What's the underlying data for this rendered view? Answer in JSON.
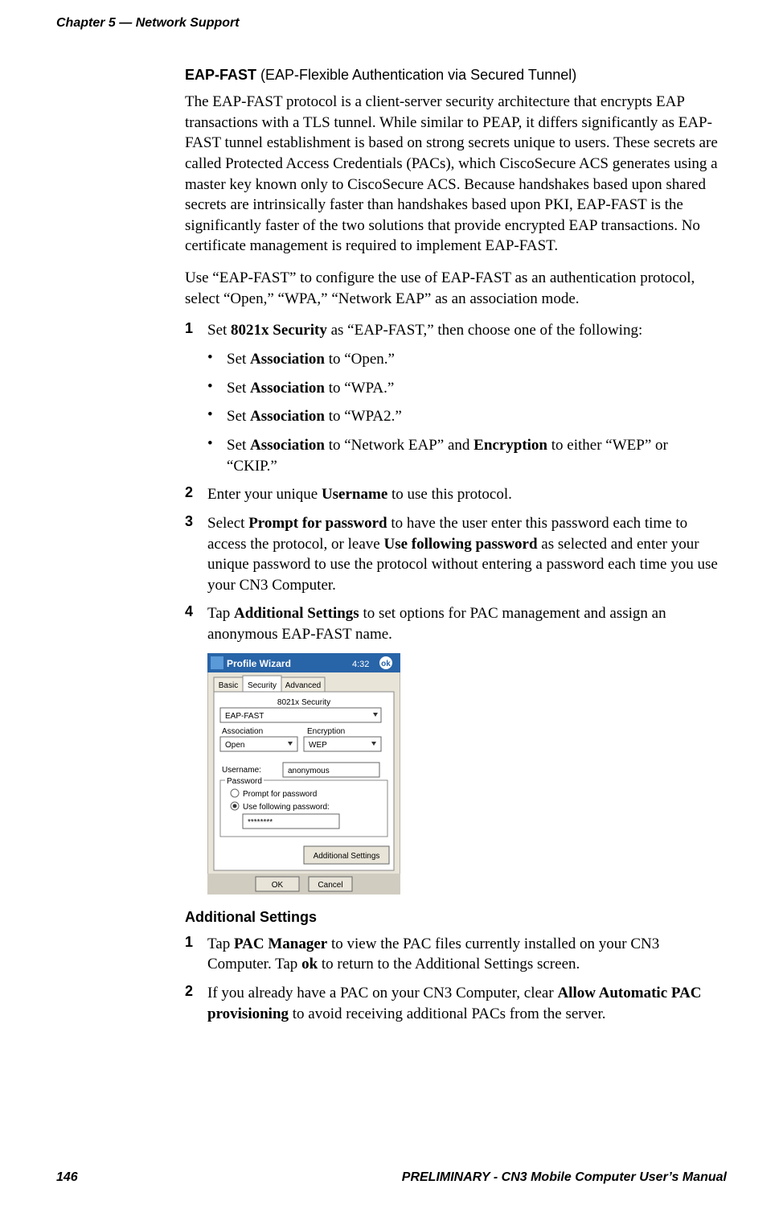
{
  "header": "Chapter 5 — Network Support",
  "section_title_bold": "EAP-FAST",
  "section_title_rest": " (EAP-Flexible Authentication via Secured Tunnel)",
  "para1": "The EAP-FAST protocol is a client-server security architecture that encrypts EAP transactions with a TLS tunnel. While similar to PEAP, it differs significantly as EAP-FAST tunnel establishment is based on strong secrets unique to users. These secrets are called Protected Access Credentials (PACs), which CiscoSecure ACS generates using a master key known only to CiscoSecure ACS. Because handshakes based upon shared secrets are intrinsically faster than handshakes based upon PKI, EAP-FAST is the significantly faster of the two solutions that provide encrypted EAP transactions. No certificate management is required to implement EAP-FAST.",
  "para2": "Use “EAP-FAST” to configure the use of EAP-FAST as an authentication protocol, select “Open,” “WPA,” “Network EAP” as an association mode.",
  "ol1": {
    "num": "1",
    "pre": "Set ",
    "bold": "8021x Security",
    "post": " as “EAP-FAST,” then choose one of the following:"
  },
  "ul_items": [
    {
      "pre": "Set ",
      "bold": "Association",
      "post": " to “Open.”"
    },
    {
      "pre": "Set ",
      "bold": "Association",
      "post": " to “WPA.”"
    },
    {
      "pre": "Set ",
      "bold": "Association",
      "post": " to “WPA2.”"
    },
    {
      "pre": "Set ",
      "bold1": "Association",
      "mid": " to “Network EAP” and ",
      "bold2": "Encryption",
      "post": " to either “WEP” or “CKIP.”"
    }
  ],
  "ol2": {
    "num": "2",
    "pre": "Enter your unique ",
    "bold": "Username",
    "post": " to use this protocol."
  },
  "ol3": {
    "num": "3",
    "pre": "Select ",
    "bold1": "Prompt for password",
    "mid": " to have the user enter this password each time to access the protocol, or leave ",
    "bold2": "Use following password",
    "post": " as selected and enter your unique password to use the protocol without entering a password each time you use your CN3 Computer."
  },
  "ol4": {
    "num": "4",
    "pre": "Tap ",
    "bold": "Additional Settings",
    "post": " to set options for PAC management and assign an anonymous EAP-FAST name."
  },
  "subheading": "Additional Settings",
  "as_ol1": {
    "num": "1",
    "pre": "Tap ",
    "bold1": "PAC Manager",
    "mid": " to view the PAC files currently installed on your CN3 Computer. Tap ",
    "bold2": "ok",
    "post": " to return to the Additional Settings screen."
  },
  "as_ol2": {
    "num": "2",
    "pre": "If you already have a PAC on your CN3 Computer, clear ",
    "bold": "Allow Automatic PAC provisioning",
    "post": " to avoid receiving additional PACs from the server."
  },
  "screenshot": {
    "title": "Profile Wizard",
    "time": "4:32",
    "ok": "ok",
    "tabs": [
      "Basic",
      "Security",
      "Advanced"
    ],
    "sec_label": "8021x Security",
    "sec_value": "EAP-FAST",
    "assoc_label": "Association",
    "assoc_value": "Open",
    "enc_label": "Encryption",
    "enc_value": "WEP",
    "user_label": "Username:",
    "user_value": "anonymous",
    "pass_group": "Password",
    "prompt": "Prompt for password",
    "usefollowing": "Use following password:",
    "pass_value": "********",
    "addl_btn": "Additional Settings",
    "ok_btn": "OK",
    "cancel_btn": "Cancel"
  },
  "footer": {
    "left": "146",
    "right": "PRELIMINARY - CN3 Mobile Computer User’s Manual"
  }
}
